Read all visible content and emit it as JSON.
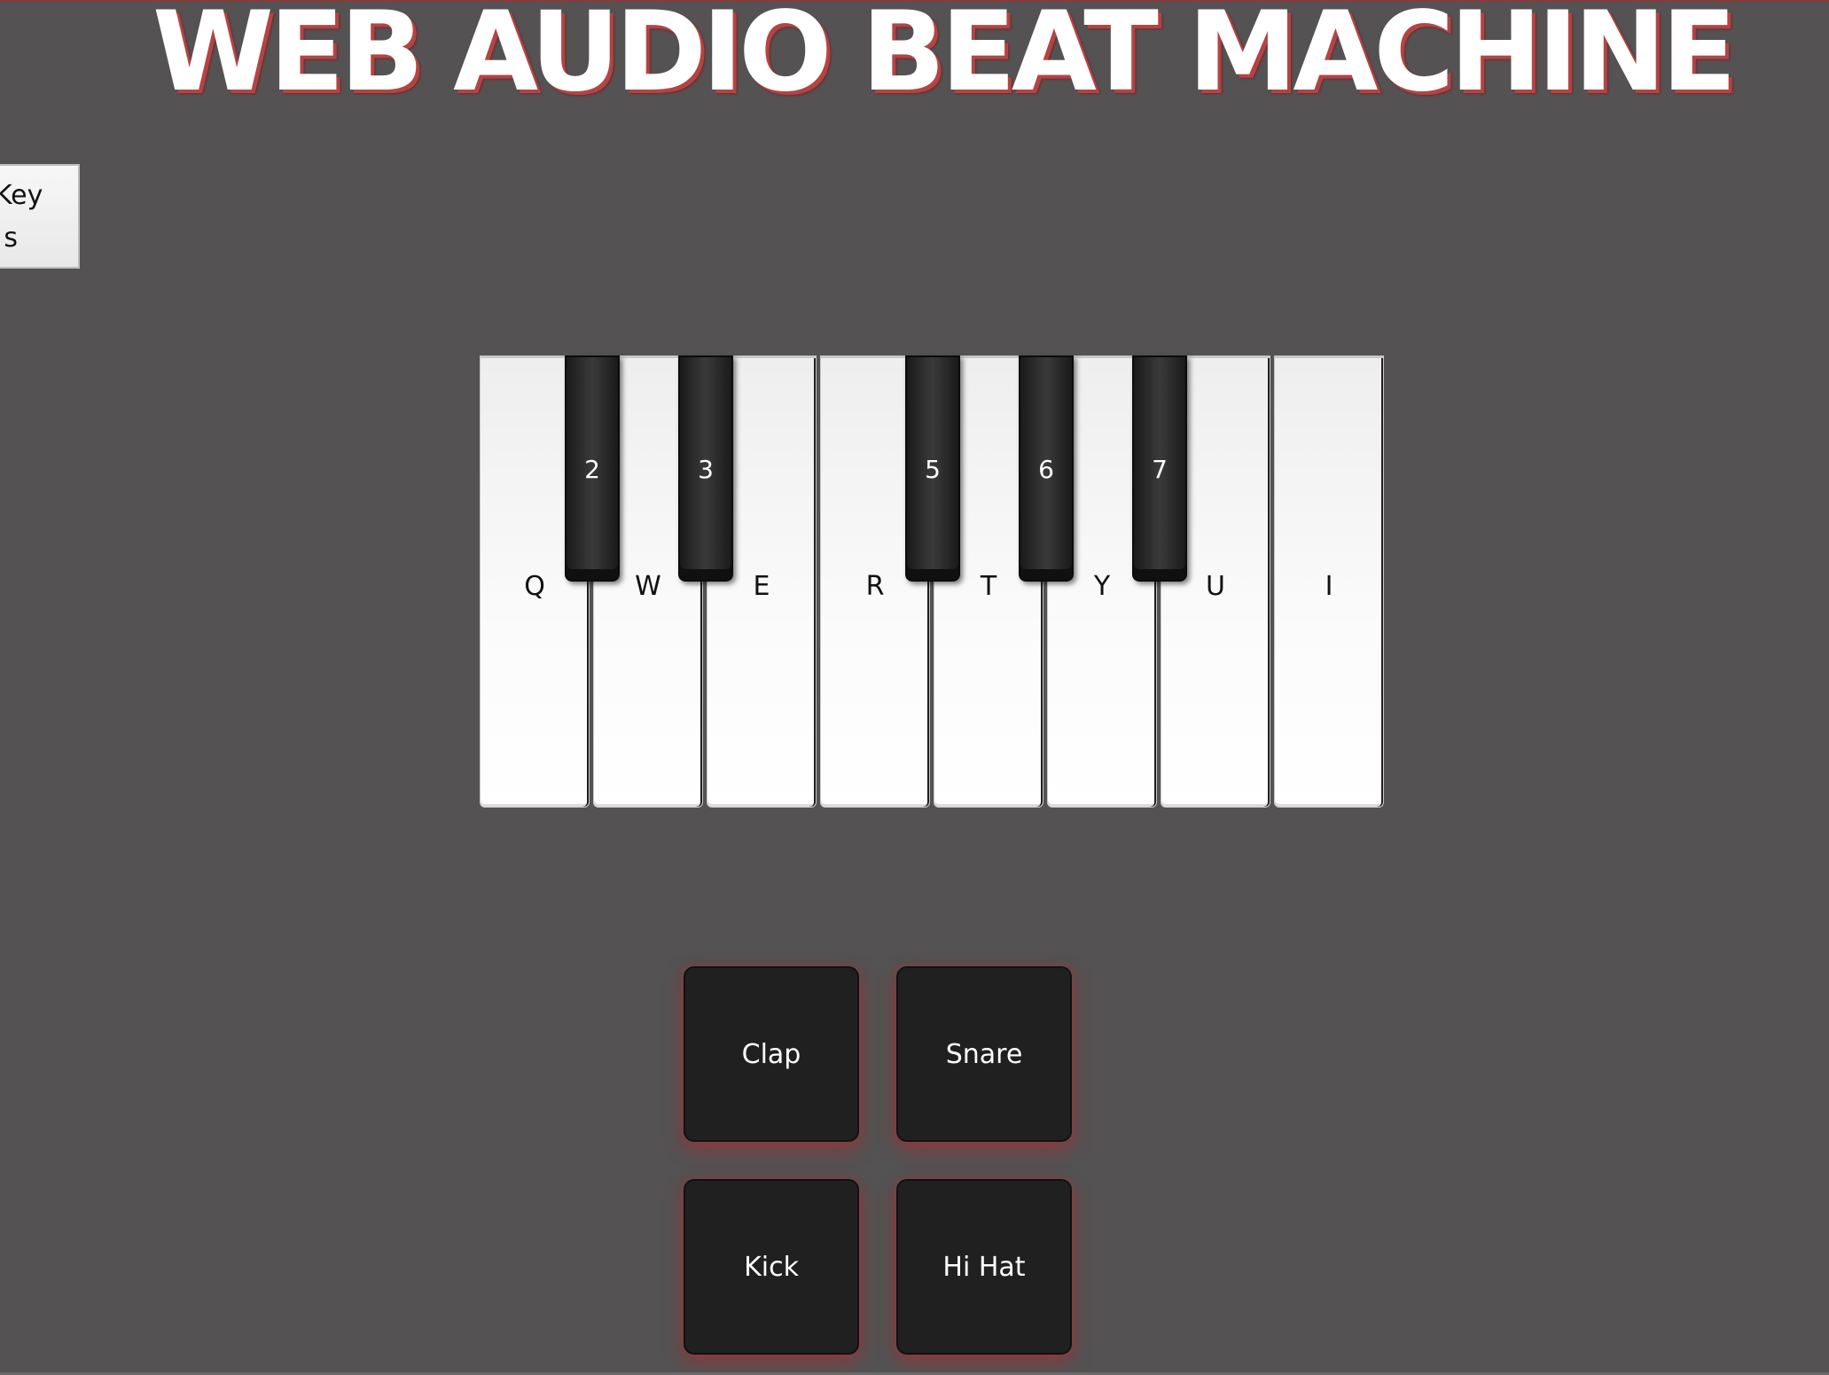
{
  "page": {
    "title": "WEB AUDIO BEAT MACHINE",
    "colors": {
      "background": "#545253",
      "title_text": "#ffffff",
      "title_shadow": "#b44444",
      "pad_background": "#212021",
      "pad_glow": "#b42828"
    }
  },
  "key_toggle": {
    "line1": "Key",
    "line2": "s"
  },
  "piano": {
    "white_keys": [
      {
        "label": "Q"
      },
      {
        "label": "W"
      },
      {
        "label": "E"
      },
      {
        "label": "R"
      },
      {
        "label": "T"
      },
      {
        "label": "Y"
      },
      {
        "label": "U"
      },
      {
        "label": "I"
      }
    ],
    "black_keys": [
      {
        "label": "2"
      },
      {
        "label": "3"
      },
      {
        "label": "5"
      },
      {
        "label": "6"
      },
      {
        "label": "7"
      }
    ]
  },
  "drum_pads": [
    {
      "label": "Clap"
    },
    {
      "label": "Snare"
    },
    {
      "label": "Kick"
    },
    {
      "label": "Hi Hat"
    }
  ]
}
